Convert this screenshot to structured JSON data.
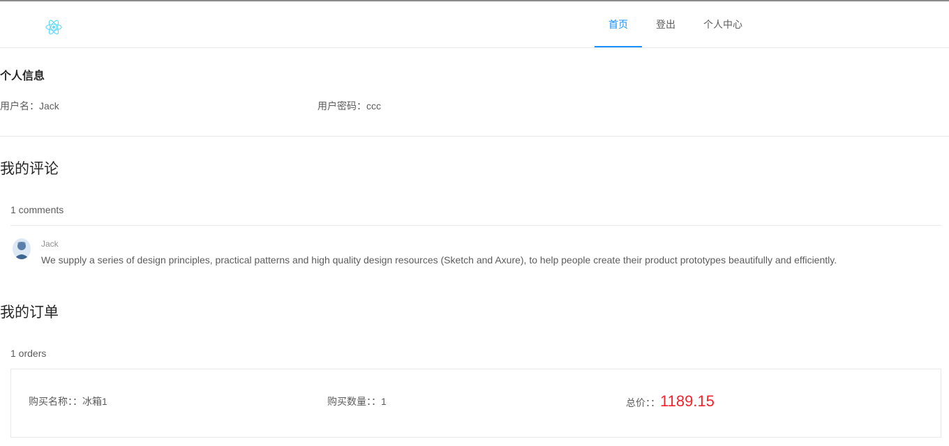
{
  "nav": {
    "items": [
      {
        "label": "首页",
        "active": true
      },
      {
        "label": "登出",
        "active": false
      },
      {
        "label": "个人中心",
        "active": false
      }
    ]
  },
  "profile": {
    "title": "个人信息",
    "username_label": "用户名：",
    "username": "Jack",
    "password_label": "用户密码：",
    "password": "ccc"
  },
  "comments": {
    "title": "我的评论",
    "count_text": "1 comments",
    "items": [
      {
        "author": "Jack",
        "content": "We supply a series of design principles, practical patterns and high quality design resources (Sketch and Axure), to help people create their product prototypes beautifully and efficiently."
      }
    ]
  },
  "orders": {
    "title": "我的订单",
    "count_text": "1 orders",
    "items": [
      {
        "name_label": "购买名称：：",
        "name": "冰箱1",
        "qty_label": "购买数量：：",
        "qty": "1",
        "total_label": "总价：：",
        "total": "1189.15"
      }
    ]
  },
  "colors": {
    "accent": "#1890ff",
    "price": "#f5222d"
  },
  "icons": {
    "logo": "react-logo-icon",
    "avatar": "user-avatar"
  }
}
